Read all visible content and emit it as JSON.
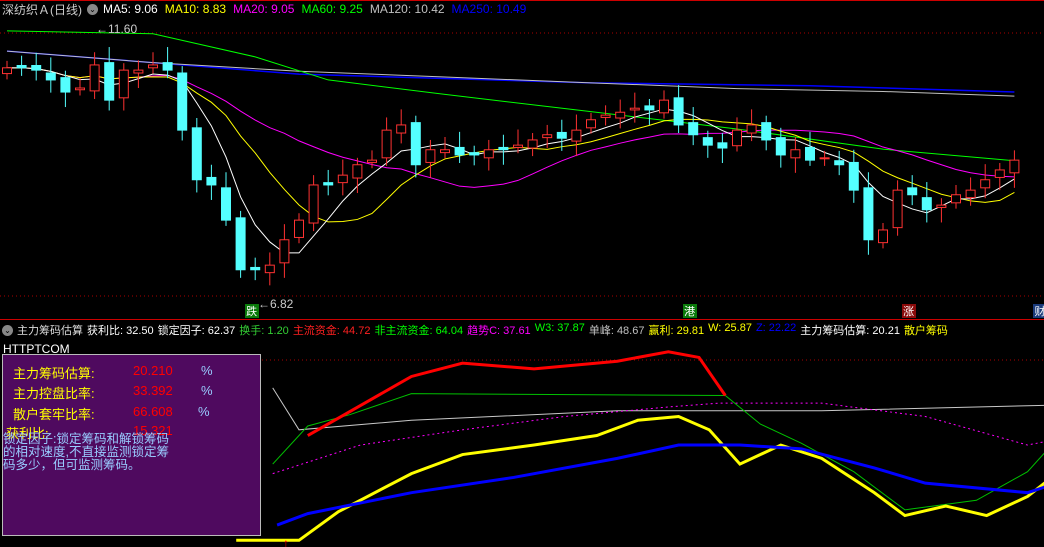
{
  "header": {
    "title": "深纺织Ａ(日线)",
    "ma": [
      {
        "label": "MA5: 9.06",
        "color": "#ffffff"
      },
      {
        "label": "MA10: 8.83",
        "color": "#ffff00"
      },
      {
        "label": "MA20: 9.05",
        "color": "#ff00ff"
      },
      {
        "label": "MA60: 9.25",
        "color": "#00ff00"
      },
      {
        "label": "MA120: 10.42",
        "color": "#c0c0c0"
      },
      {
        "label": "MA250: 10.49",
        "color": "#0000ff"
      }
    ]
  },
  "price_chart": {
    "high_label": "11.60",
    "low_label": "6.82",
    "high": 11.6,
    "low": 6.82,
    "closes": [
      10.91,
      10.91,
      10.87,
      10.7,
      10.49,
      10.56,
      10.96,
      10.35,
      10.87,
      10.87,
      10.96,
      10.87,
      9.83,
      8.97,
      8.88,
      8.27,
      7.41,
      7.41,
      7.49,
      7.93,
      8.27,
      8.88,
      8.88,
      9.05,
      9.23,
      9.31,
      9.83,
      9.92,
      9.23,
      9.49,
      9.49,
      9.4,
      9.4,
      9.49,
      9.49,
      9.57,
      9.66,
      9.75,
      9.69,
      9.83,
      10.01,
      10.09,
      10.14,
      10.21,
      10.18,
      10.35,
      9.92,
      9.75,
      9.57,
      9.52,
      9.83,
      9.92,
      9.66,
      9.4,
      9.49,
      9.31,
      9.35,
      9.23,
      8.79,
      7.93,
      8.1,
      8.79,
      8.71,
      8.45,
      8.53,
      8.71,
      8.79,
      8.97,
      9.14,
      9.31
    ],
    "ma60": [
      [
        0,
        11.55
      ],
      [
        10,
        11.5
      ],
      [
        17,
        11.1
      ],
      [
        22,
        10.7
      ],
      [
        30,
        10.45
      ],
      [
        40,
        10.15
      ],
      [
        50,
        9.85
      ],
      [
        60,
        9.5
      ],
      [
        69,
        9.3
      ]
    ],
    "ma120": [
      [
        0,
        11.2
      ],
      [
        10,
        11.0
      ],
      [
        20,
        10.85
      ],
      [
        30,
        10.75
      ],
      [
        40,
        10.65
      ],
      [
        50,
        10.55
      ],
      [
        60,
        10.5
      ],
      [
        69,
        10.42
      ]
    ],
    "ma250": [
      [
        0,
        11.2
      ],
      [
        20,
        10.8
      ],
      [
        40,
        10.65
      ],
      [
        55,
        10.6
      ],
      [
        69,
        10.49
      ]
    ]
  },
  "markers": [
    {
      "text": "跌",
      "color": "#0a7a0a",
      "bar": 16
    },
    {
      "text": "港",
      "color": "#0a7a0a",
      "bar": 46
    },
    {
      "text": "涨",
      "color": "#8a0a0a",
      "bar": 61
    },
    {
      "text": "财",
      "color": "#1a3a7a",
      "bar": 70
    }
  ],
  "indicator": {
    "title": "主力筹码估算",
    "items": [
      {
        "label": "获利比: 32.50",
        "color": "#ffffff"
      },
      {
        "label": "锁定因子: 62.37",
        "color": "#ffffff"
      },
      {
        "label": "换手: 1.20",
        "color": "#33cc33"
      },
      {
        "label": "主流资金: 44.72",
        "color": "#ff2020"
      },
      {
        "label": "非主流资金: 64.04",
        "color": "#00ff00"
      },
      {
        "label": "趋势C: 37.61",
        "color": "#ff00ff"
      },
      {
        "label": "W3: 37.87",
        "color": "#00ff00"
      },
      {
        "label": "单峰: 48.67",
        "color": "#c0c0c0"
      },
      {
        "label": "赢利: 29.81",
        "color": "#ffff00"
      },
      {
        "label": "W: 25.87",
        "color": "#ffff00"
      },
      {
        "label": "Z: 22.22",
        "color": "#0000ff"
      },
      {
        "label": "主力筹码估算: 20.21",
        "color": "#ffffff"
      },
      {
        "label": "散户筹码",
        "color": "#ffff00"
      }
    ]
  },
  "site": "HTTPTCOM",
  "info_box": {
    "rows": [
      {
        "label": "主力筹码估算:",
        "value": "20.210",
        "unit": "%"
      },
      {
        "label": "主力控盘比率:",
        "value": "33.392",
        "unit": "%"
      },
      {
        "label": "散户套牢比率:",
        "value": "66.608",
        "unit": "%"
      },
      {
        "label": "获利比:",
        "value": "15.321"
      }
    ],
    "note": "锁定因子:锁定筹码和解锁筹码的相对速度,不直接监测锁定筹码多少，但可监测筹码。"
  },
  "chart_data": {
    "type": "line",
    "ylim": [
      0,
      105
    ],
    "series": [
      {
        "name": "white",
        "color": "#c8c8c8",
        "width": 1,
        "points": [
          [
            18.2,
            83
          ],
          [
            20,
            61
          ],
          [
            27.7,
            66
          ],
          [
            41.8,
            71
          ],
          [
            55.8,
            71
          ],
          [
            71.9,
            74
          ]
        ]
      },
      {
        "name": "magenta",
        "color": "#ff00ff",
        "width": 1,
        "dash": true,
        "points": [
          [
            18.2,
            38
          ],
          [
            24.2,
            53
          ],
          [
            31.2,
            61
          ],
          [
            38.2,
            68
          ],
          [
            45.3,
            73
          ],
          [
            48.8,
            75
          ],
          [
            55.8,
            75
          ],
          [
            62.9,
            68
          ],
          [
            69.9,
            53
          ],
          [
            71.9,
            56
          ]
        ]
      },
      {
        "name": "green",
        "color": "#00c000",
        "width": 1,
        "points": [
          [
            18.2,
            43
          ],
          [
            20.6,
            63
          ],
          [
            23.5,
            69
          ],
          [
            27.7,
            80
          ],
          [
            49.2,
            79
          ],
          [
            51.6,
            64
          ],
          [
            54.4,
            54
          ],
          [
            58,
            39
          ],
          [
            61.5,
            19
          ],
          [
            66.4,
            24
          ],
          [
            69.9,
            39
          ],
          [
            71.9,
            56
          ]
        ]
      },
      {
        "name": "red",
        "color": "#ff0000",
        "width": 3,
        "points": [
          [
            20.6,
            58
          ],
          [
            27.7,
            89
          ],
          [
            31.2,
            96
          ],
          [
            36.1,
            93
          ],
          [
            41.8,
            97
          ],
          [
            45.3,
            102
          ],
          [
            47.4,
            99
          ],
          [
            49.2,
            79
          ]
        ]
      },
      {
        "name": "yellow",
        "color": "#ffff00",
        "width": 3,
        "points": [
          [
            15.7,
            3
          ],
          [
            20,
            3
          ],
          [
            22.7,
            18
          ],
          [
            27.7,
            38
          ],
          [
            31.2,
            48
          ],
          [
            36.1,
            53
          ],
          [
            40.4,
            58
          ],
          [
            43.2,
            66
          ],
          [
            46,
            68
          ],
          [
            48.1,
            61
          ],
          [
            50.2,
            43
          ],
          [
            53,
            53
          ],
          [
            55.8,
            46
          ],
          [
            59.4,
            28
          ],
          [
            61.5,
            16
          ],
          [
            64.3,
            21
          ],
          [
            67.1,
            16
          ],
          [
            69.9,
            26
          ],
          [
            71.9,
            38
          ]
        ]
      },
      {
        "name": "blue",
        "color": "#0000ff",
        "width": 3,
        "points": [
          [
            18.5,
            11
          ],
          [
            20.6,
            17
          ],
          [
            27.7,
            28
          ],
          [
            34.7,
            36
          ],
          [
            41.8,
            46
          ],
          [
            46,
            53
          ],
          [
            50.2,
            53
          ],
          [
            54.4,
            51
          ],
          [
            59.4,
            41
          ],
          [
            62.9,
            33
          ],
          [
            69.9,
            28
          ],
          [
            71.9,
            33
          ]
        ]
      }
    ]
  }
}
